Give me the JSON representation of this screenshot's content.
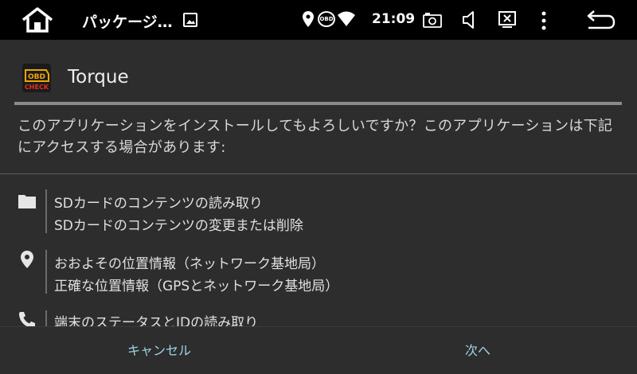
{
  "status_bar": {
    "app_name": "パッケージ…",
    "obd_label": "OBD",
    "time": "21:09"
  },
  "header": {
    "app_title": "Torque",
    "icon_top_text": "OBD",
    "icon_bottom_text": "CHECK"
  },
  "intro_text": "このアプリケーションをインストールしてもよろしいですか？このアプリケーションは下記にアクセスする場合があります:",
  "permissions": [
    {
      "icon": "folder-icon",
      "lines": [
        "SDカードのコンテンツの読み取り",
        "SDカードのコンテンツの変更または削除"
      ]
    },
    {
      "icon": "location-pin-icon",
      "lines": [
        "おおよその位置情報（ネットワーク基地局）",
        "正確な位置情報（GPSとネットワーク基地局）"
      ]
    },
    {
      "icon": "phone-icon",
      "lines": [
        "端末のステータスとIDの読み取り"
      ]
    }
  ],
  "buttons": {
    "cancel": "キャンセル",
    "next": "次へ"
  },
  "colors": {
    "background": "#2d2d2d",
    "status_bar": "#000000",
    "button_text": "#9fd4e2",
    "rule": "#8a8a8a"
  }
}
